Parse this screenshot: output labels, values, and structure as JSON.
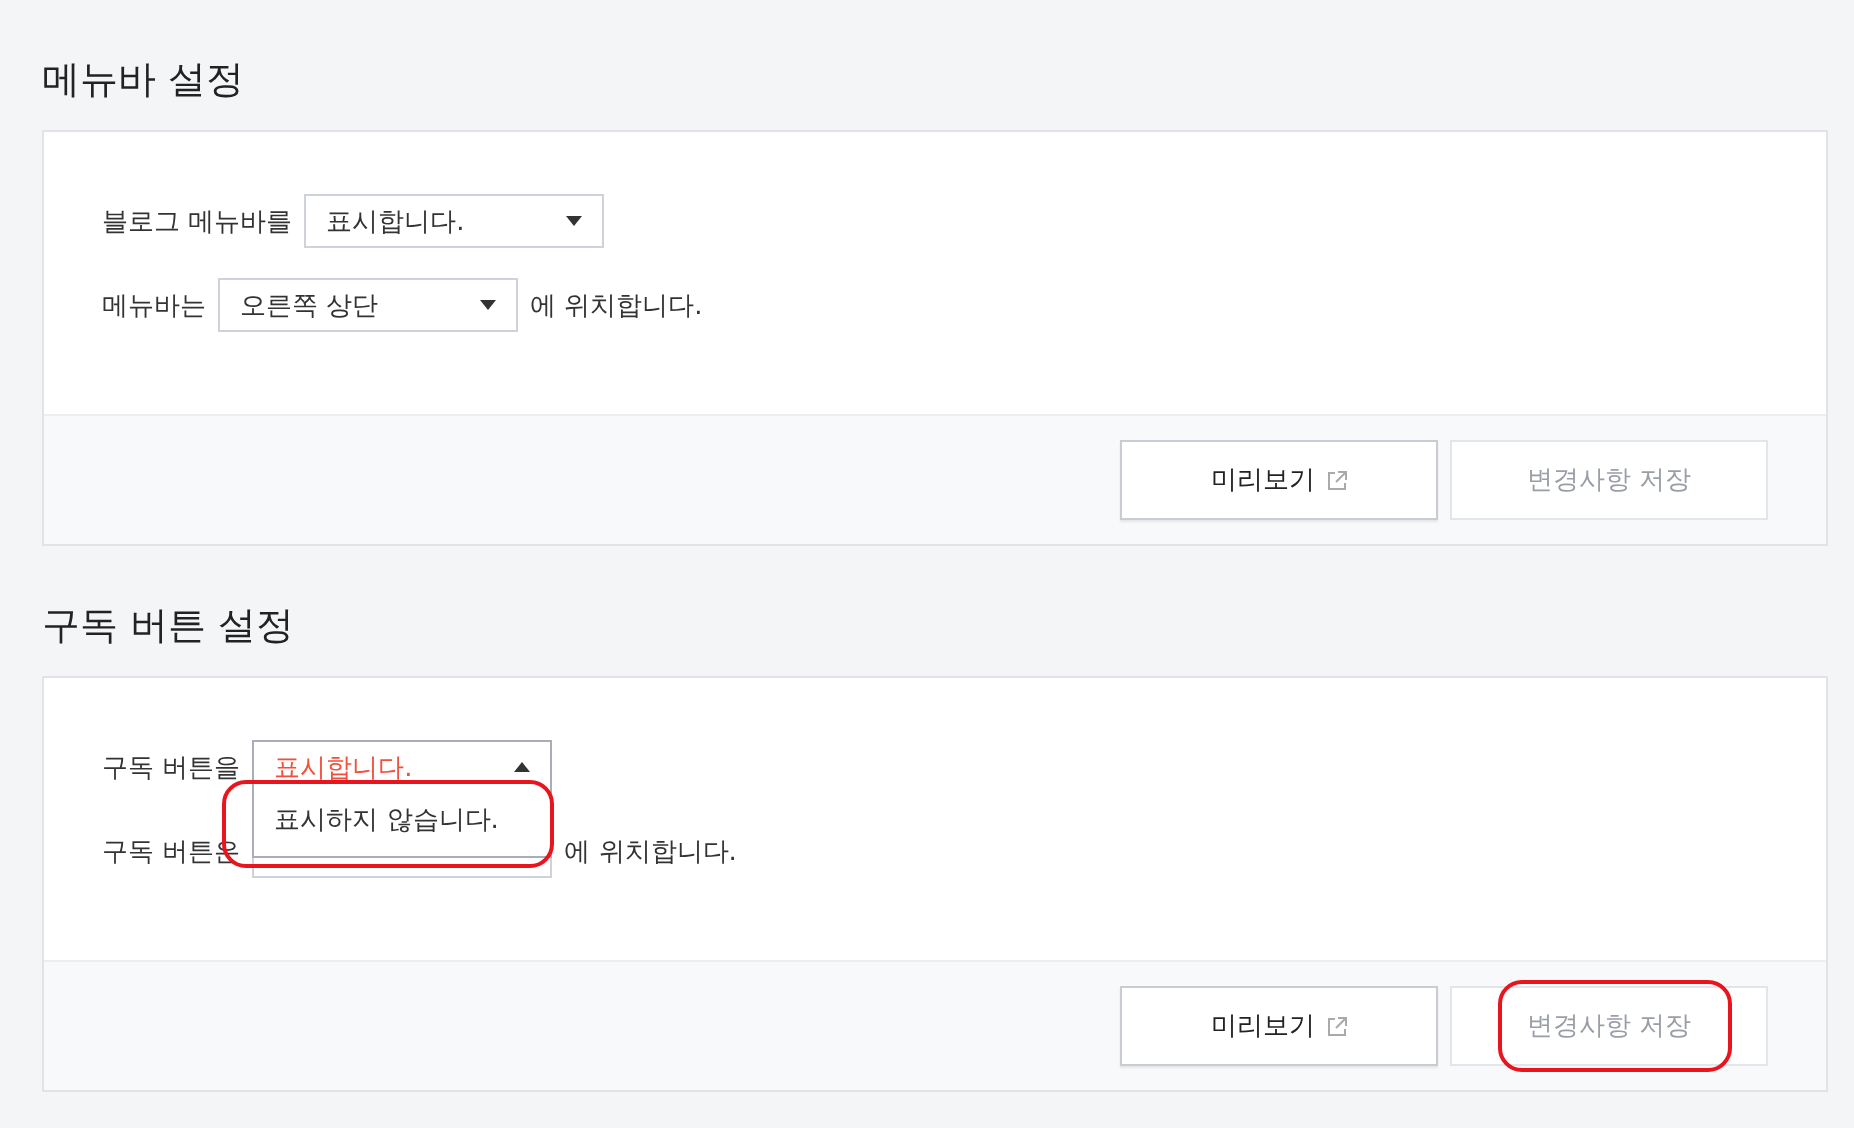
{
  "sections": [
    {
      "title": "메뉴바 설정",
      "rows": [
        {
          "label": "블로그 메뉴바를",
          "select": {
            "value": "표시합니다.",
            "expanded": false
          }
        },
        {
          "label": "메뉴바는",
          "select": {
            "value": "오른쪽 상단",
            "expanded": false
          },
          "suffix": "에 위치합니다."
        }
      ],
      "buttons": [
        {
          "label": "미리보기",
          "kind": "preview",
          "disabled": false,
          "circled": false
        },
        {
          "label": "변경사항 저장",
          "kind": "save",
          "disabled": true,
          "circled": false
        }
      ]
    },
    {
      "title": "구독 버튼 설정",
      "rows": [
        {
          "label": "구독 버튼을",
          "select": {
            "value": "표시합니다.",
            "expanded": true,
            "options": [
              {
                "label": "표시하지 않습니다.",
                "circled": true
              }
            ]
          }
        },
        {
          "label": "구독 버튼은",
          "select": {
            "expanded": false
          },
          "suffix": "에 위치합니다."
        }
      ],
      "buttons": [
        {
          "label": "미리보기",
          "kind": "preview",
          "disabled": false,
          "circled": false
        },
        {
          "label": "변경사항 저장",
          "kind": "save",
          "disabled": true,
          "circled": true
        }
      ]
    }
  ]
}
